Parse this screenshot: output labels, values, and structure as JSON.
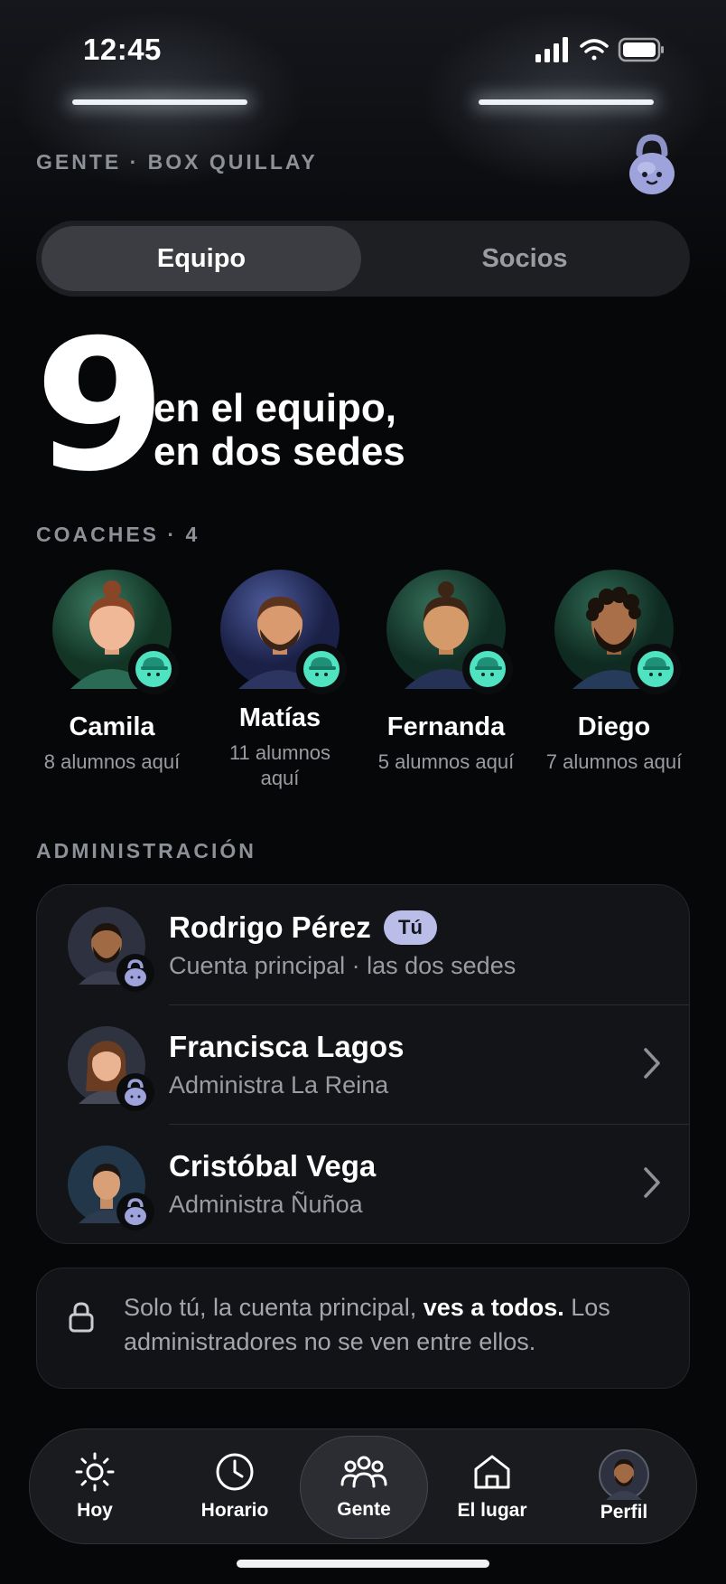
{
  "status": {
    "time": "12:45"
  },
  "header": {
    "section_label": "GENTE · BOX QUILLAY",
    "logo_icon": "kettlebell-mascot-icon"
  },
  "tabs": {
    "active": "Equipo",
    "inactive": "Socios"
  },
  "hero": {
    "number": "9",
    "line1": "en el equipo,",
    "line2": "en dos sedes"
  },
  "coaches": {
    "label": "COACHES · 4",
    "items": [
      {
        "name": "Camila",
        "sub": "8 alumnos aquí"
      },
      {
        "name": "Matías",
        "sub": "11 alumnos aquí"
      },
      {
        "name": "Fernanda",
        "sub": "5 alumnos aquí"
      },
      {
        "name": "Diego",
        "sub": "7 alumnos aquí"
      }
    ]
  },
  "admin": {
    "label": "ADMINISTRACIÓN",
    "rows": [
      {
        "name": "Rodrigo Pérez",
        "pill": "Tú",
        "desc": "Cuenta principal · las dos sedes"
      },
      {
        "name": "Francisca Lagos",
        "desc": "Administra La Reina"
      },
      {
        "name": "Cristóbal Vega",
        "desc": "Administra Ñuñoa"
      }
    ]
  },
  "notice": {
    "pre": "Solo tú, la cuenta principal, ",
    "bold": "ves a todos.",
    "post": " Los administradores no se ven entre ellos."
  },
  "tabbar": {
    "items": [
      {
        "label": "Hoy",
        "icon": "sun-icon"
      },
      {
        "label": "Horario",
        "icon": "clock-icon"
      },
      {
        "label": "Gente",
        "icon": "people-icon"
      },
      {
        "label": "El lugar",
        "icon": "house-icon"
      },
      {
        "label": "Perfil",
        "icon": "avatar-icon"
      }
    ]
  },
  "colors": {
    "accent_teal": "#4fe3c1",
    "pill_lavender": "#b9bde8",
    "bg": "#060709"
  }
}
